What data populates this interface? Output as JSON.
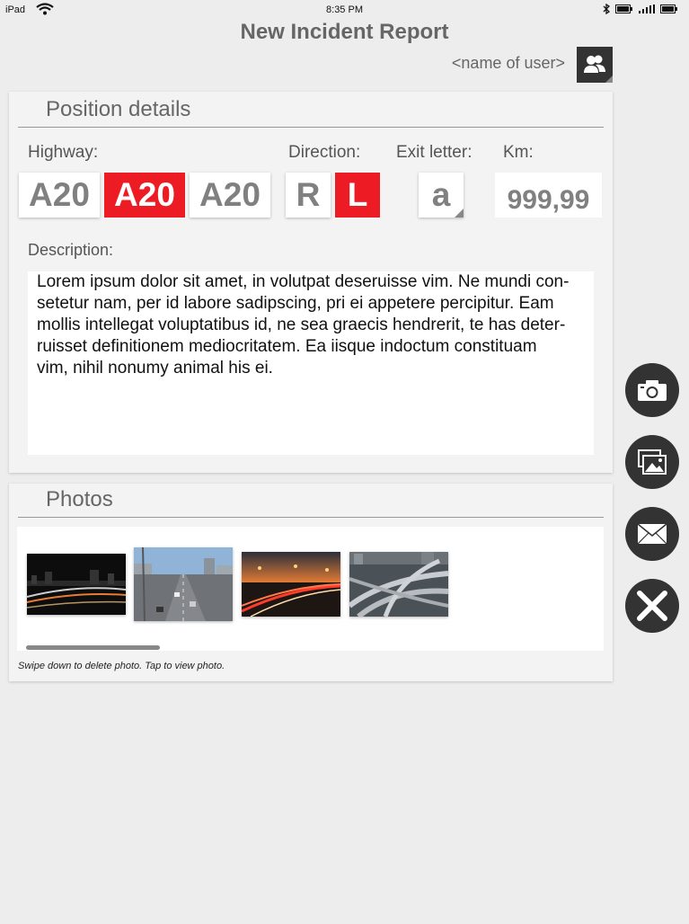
{
  "status": {
    "carrier": "iPad",
    "time": "8:35 PM"
  },
  "header": {
    "title": "New Incident Report",
    "username": "<name of user>"
  },
  "position": {
    "section_title": "Position details",
    "highway_label": "Highway:",
    "highway_options": [
      {
        "label": "A20",
        "selected": false
      },
      {
        "label": "A20",
        "selected": true
      },
      {
        "label": "A20",
        "selected": false
      }
    ],
    "direction_label": "Direction:",
    "direction_options": [
      {
        "label": "R",
        "selected": false
      },
      {
        "label": "L",
        "selected": true
      }
    ],
    "exit_label": "Exit letter:",
    "exit_value": "a",
    "km_label": "Km:",
    "km_value": "999,99",
    "description_label": "Description:",
    "description_lines": [
      "Lorem ipsum dolor sit amet, in volutpat deseruisse vim. Ne mundi con-",
      "setetur nam, per id labore sadipscing, pri ei appetere percipitur. Eam",
      "mollis intellegat voluptatibus id, ne sea graecis hendrerit, te has deter-",
      "ruisset definitionem mediocritatem. Ea iisque indoctum constituam",
      "vim, nihil nonumy animal his ei."
    ]
  },
  "photos": {
    "section_title": "Photos",
    "items": [
      "night-city-traffic-photo",
      "highway-daytime-photo",
      "sunset-highway-traffic-photo",
      "highway-interchange-photo"
    ],
    "hint": "Swipe down to delete photo. Tap to view photo."
  },
  "actions": [
    "camera-icon",
    "gallery-icon",
    "mail-icon",
    "close-icon"
  ],
  "colors": {
    "accent": "#ed1c24",
    "dark": "#333333",
    "background": "#ededee"
  }
}
